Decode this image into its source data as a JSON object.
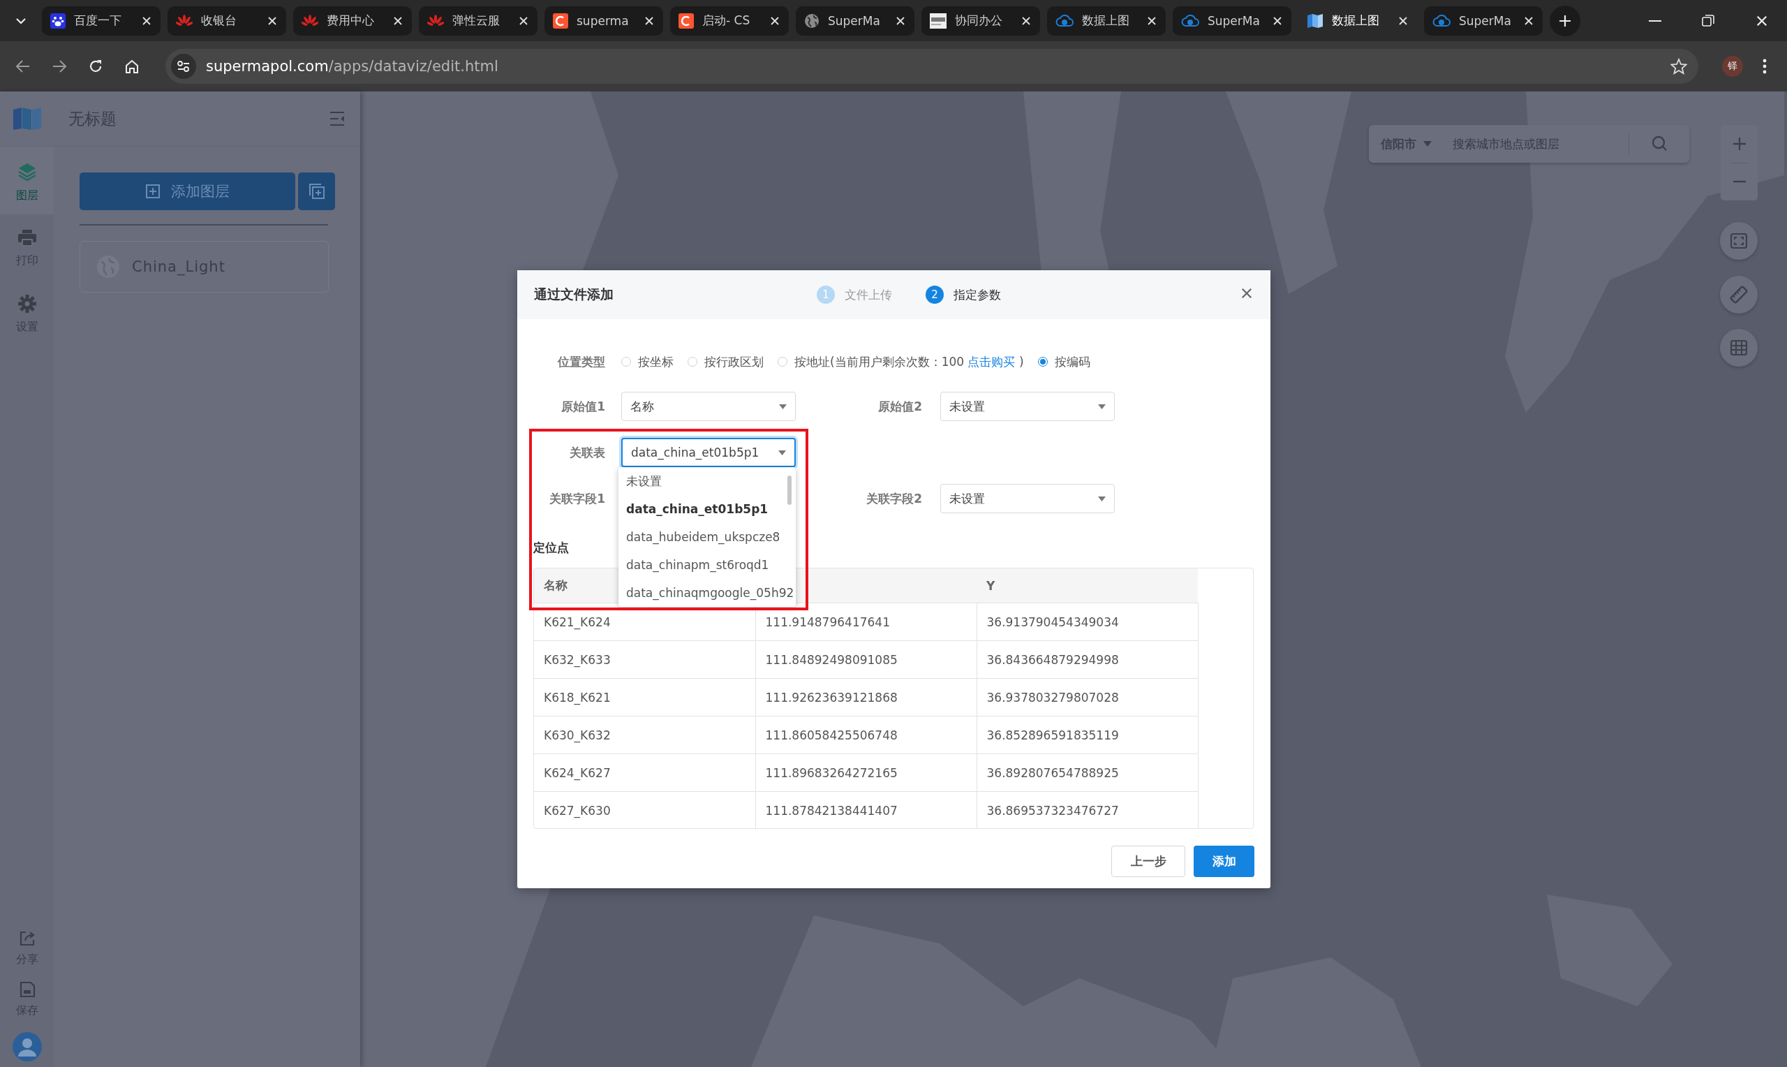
{
  "browser": {
    "tabs": [
      {
        "kind": "paw",
        "title": "百度一下",
        "selected": false
      },
      {
        "kind": "flower",
        "title": "收银台",
        "selected": false
      },
      {
        "kind": "flower",
        "title": "费用中心",
        "selected": false
      },
      {
        "kind": "flower",
        "title": "弹性云服",
        "selected": false
      },
      {
        "kind": "c-logo",
        "title": "superma",
        "selected": false
      },
      {
        "kind": "c-logo",
        "title": "启动- CS",
        "selected": false
      },
      {
        "kind": "globe",
        "title": "SuperMa",
        "selected": false
      },
      {
        "kind": "doc",
        "title": "协同办公",
        "selected": false
      },
      {
        "kind": "cloud",
        "title": "数据上图",
        "selected": false
      },
      {
        "kind": "cloud",
        "title": "SuperMa",
        "selected": false
      },
      {
        "kind": "map",
        "title": "数据上图",
        "selected": true
      },
      {
        "kind": "cloud",
        "title": "SuperMa",
        "selected": false
      }
    ],
    "address": {
      "host": "supermapol.com",
      "path": "/apps/dataviz/edit.html"
    },
    "profile": "铎"
  },
  "app": {
    "title": "无标题",
    "nav": [
      {
        "kind": "layers",
        "label": "图层",
        "selected": true
      },
      {
        "kind": "print",
        "label": "打印",
        "selected": false
      },
      {
        "kind": "gear",
        "label": "设置",
        "selected": false
      }
    ],
    "nav_bottom": [
      {
        "kind": "share",
        "label": "分享"
      },
      {
        "kind": "save",
        "label": "保存"
      }
    ],
    "add_layer": "添加图层",
    "layers": [
      {
        "name": "China_Light"
      }
    ]
  },
  "map": {
    "city": "信阳市",
    "search_placeholder": "搜索城市地点或图层"
  },
  "dialog": {
    "title": "通过文件添加",
    "steps": [
      {
        "number": "1",
        "label": "文件上传",
        "selected": false
      },
      {
        "number": "2",
        "label": "指定参数",
        "selected": true
      }
    ],
    "location_type": {
      "label": "位置类型",
      "options": [
        {
          "label": "按坐标",
          "selected": false
        },
        {
          "label": "按行政区划",
          "selected": false
        },
        {
          "label": "按地址(当前用户剩余次数：100",
          "link": "点击购买",
          "label_end": ")",
          "selected": false
        },
        {
          "label": "按编码",
          "selected": true
        }
      ]
    },
    "form_rows": [
      [
        {
          "label": "原始值1",
          "value": "名称",
          "expanded": false
        },
        {
          "label": "原始值2",
          "value": "未设置",
          "expanded": false
        }
      ],
      [
        {
          "label": "关联表",
          "value": "data_china_et01b5p1",
          "expanded": true,
          "options": [
            {
              "label": "未设置",
              "selected": false
            },
            {
              "label": "data_china_et01b5p1",
              "selected": true
            },
            {
              "label": "data_hubeidem_ukspcze8",
              "selected": false
            },
            {
              "label": "data_chinapm_st6roqd1",
              "selected": false
            },
            {
              "label": "data_chinaqmgoogle_05h92",
              "selected": false
            }
          ]
        }
      ],
      [
        {
          "label": "关联字段1"
        },
        {
          "label": "关联字段2",
          "value": "未设置",
          "expanded": false
        }
      ]
    ],
    "table": {
      "title": "定位点",
      "header": {
        "column_1": "名称",
        "column_3": "Y"
      },
      "rows": [
        [
          "K621_K624",
          "111.9148796417641",
          "36.913790454349034"
        ],
        [
          "K632_K633",
          "111.84892498091085",
          "36.843664879294998"
        ],
        [
          "K618_K621",
          "111.92623639121868",
          "36.937803279807028"
        ],
        [
          "K630_K632",
          "111.86058425506748",
          "36.852896591835119"
        ],
        [
          "K624_K627",
          "111.89683264272165",
          "36.892807654788925"
        ],
        [
          "K627_K630",
          "111.87842138441407",
          "36.869537323476727"
        ]
      ]
    },
    "buttons": {
      "back": "上一步",
      "add": "添加"
    }
  }
}
